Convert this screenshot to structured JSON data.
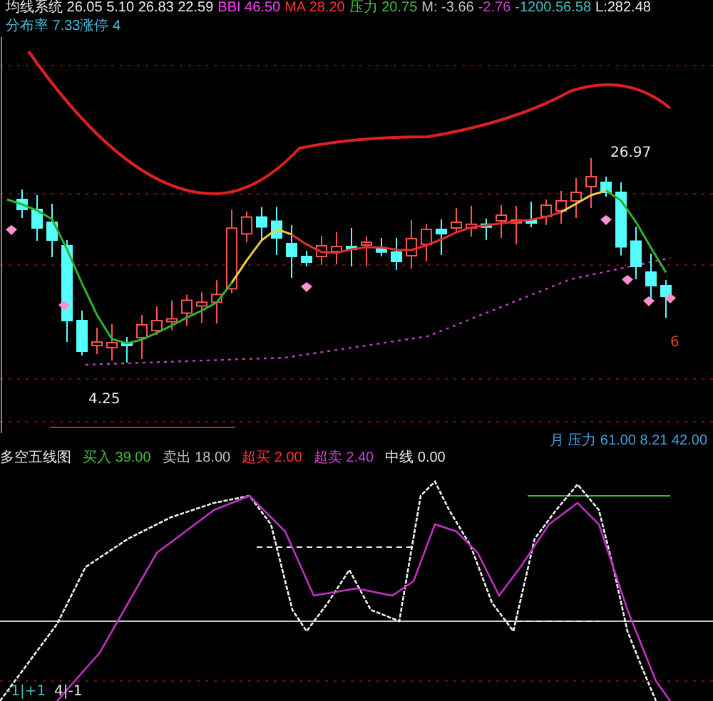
{
  "header": {
    "segments": [
      {
        "text": "均线系统 26.05 5.10 26.83 22.59",
        "color": "#e8e8e8"
      },
      {
        "text": "BBI 46.50",
        "color": "#ff40ff"
      },
      {
        "text": "MA 28.20",
        "color": "#ff3030"
      },
      {
        "text": "压力 20.75",
        "color": "#40c040"
      },
      {
        "text": "M: -3.66",
        "color": "#c0c0c0"
      },
      {
        "text": "-2.76",
        "color": "#d040d0"
      },
      {
        "text": "-1200.56.58",
        "color": "#40c0c0"
      },
      {
        "text": "L:282.48",
        "color": "#e8e8e8"
      }
    ]
  },
  "subheader": {
    "text": "分布率 7.33涨停 4",
    "color": "#40c0e0"
  },
  "price_chart": {
    "high_label": "26.97",
    "low_label": "4.25",
    "count_label": "6"
  },
  "indicator_values": {
    "text": "月 压力 61.00 8.21 42.00"
  },
  "indicator_legend": [
    {
      "text": "多空五线图",
      "color": "#e8e8e8"
    },
    {
      "text": "买入 39.00",
      "color": "#40c040"
    },
    {
      "text": "卖出 18.00",
      "color": "#c0c0c0"
    },
    {
      "text": "超买 2.00",
      "color": "#ff3030"
    },
    {
      "text": "超卖 2.40",
      "color": "#d040d0"
    },
    {
      "text": "中线 0.00",
      "color": "#e8e8e8"
    }
  ],
  "indicator_chart": {
    "labels": [
      {
        "text": "-1|+1",
        "color": "#40c0c0"
      },
      {
        "text": "4|-1",
        "color": "#e8e8e8"
      }
    ]
  }
}
